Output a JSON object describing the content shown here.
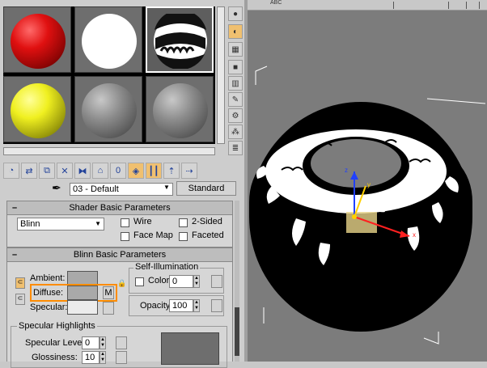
{
  "material_slots": [
    {
      "name": "red",
      "color": "#e01010"
    },
    {
      "name": "white",
      "color": "#ffffff"
    },
    {
      "name": "black-white-pattern",
      "color": "#202020"
    },
    {
      "name": "yellow",
      "color": "#f0f020"
    },
    {
      "name": "gray",
      "color": "#8a8a8a"
    },
    {
      "name": "gray",
      "color": "#8a8a8a"
    }
  ],
  "material": {
    "name": "03 - Default",
    "type_button": "Standard"
  },
  "shader_basic": {
    "title": "Shader Basic Parameters",
    "shader": "Blinn",
    "wire": "Wire",
    "two_sided": "2-Sided",
    "face_map": "Face Map",
    "faceted": "Faceted"
  },
  "blinn_basic": {
    "title": "Blinn Basic Parameters",
    "ambient": "Ambient:",
    "diffuse": "Diffuse:",
    "diffuse_map": "M",
    "specular": "Specular:",
    "self_illum_title": "Self-Illumination",
    "color_label": "Color",
    "color_value": "0",
    "opacity_label": "Opacity:",
    "opacity_value": "100"
  },
  "specular_highlights": {
    "title": "Specular Highlights",
    "level_label": "Specular Level:",
    "level_value": "0",
    "gloss_label": "Glossiness:",
    "gloss_value": "10"
  },
  "viewport": {
    "label": "ABC",
    "axis_x": "x",
    "axis_y": "y",
    "axis_z": "z"
  },
  "colors": {
    "highlight_box": "#ff8c00",
    "panel_bg": "#cdcdcd",
    "viewport_bg": "#7c7c7c"
  }
}
